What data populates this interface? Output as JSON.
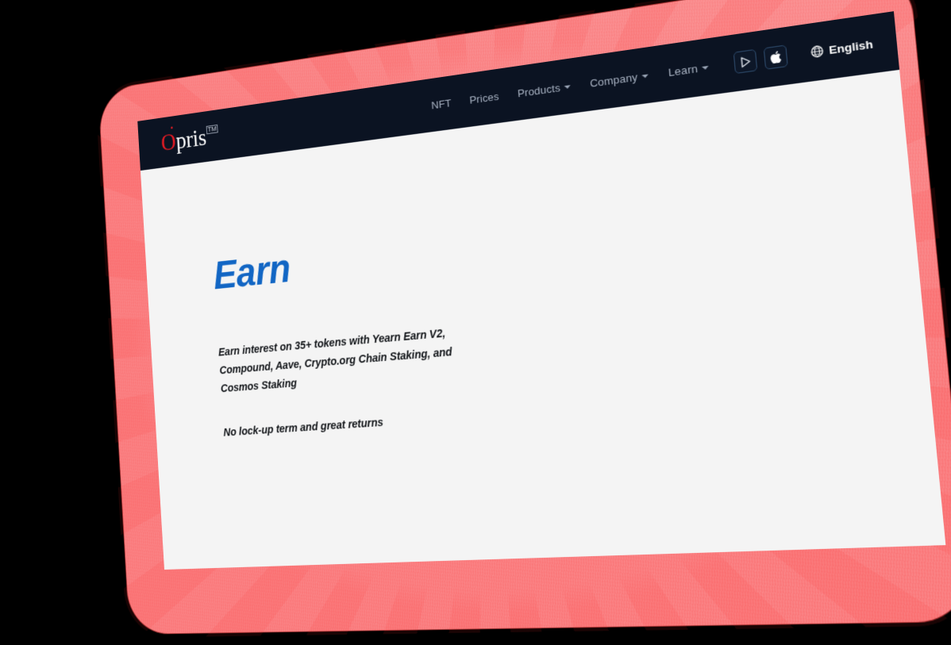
{
  "device": {
    "bezel_color": "#FA7B7D",
    "background_color": "#000000"
  },
  "site": {
    "page_background": "#F4F4F4",
    "navbar_background": "#0B1322",
    "accent_blue": "#1266C4",
    "logo_red": "#E01B24"
  },
  "navbar": {
    "logo": {
      "first_letter": "O",
      "rest": "pris",
      "trademark": "TM"
    },
    "links": [
      {
        "label": "NFT",
        "has_dropdown": false
      },
      {
        "label": "Prices",
        "has_dropdown": false
      },
      {
        "label": "Products",
        "has_dropdown": true
      },
      {
        "label": "Company",
        "has_dropdown": true
      },
      {
        "label": "Learn",
        "has_dropdown": true
      }
    ],
    "store_buttons": [
      {
        "name": "google-play",
        "icon": "play-triangle-icon"
      },
      {
        "name": "app-store",
        "icon": "apple-logo-icon"
      }
    ],
    "language": {
      "icon": "globe-icon",
      "label": "English"
    }
  },
  "hero": {
    "title": "Earn",
    "paragraph_1": "Earn interest on 35+ tokens with Yearn Earn V2, Compound, Aave, Crypto.org Chain Staking, and Cosmos Staking",
    "paragraph_2": "No lock-up term and great returns"
  }
}
